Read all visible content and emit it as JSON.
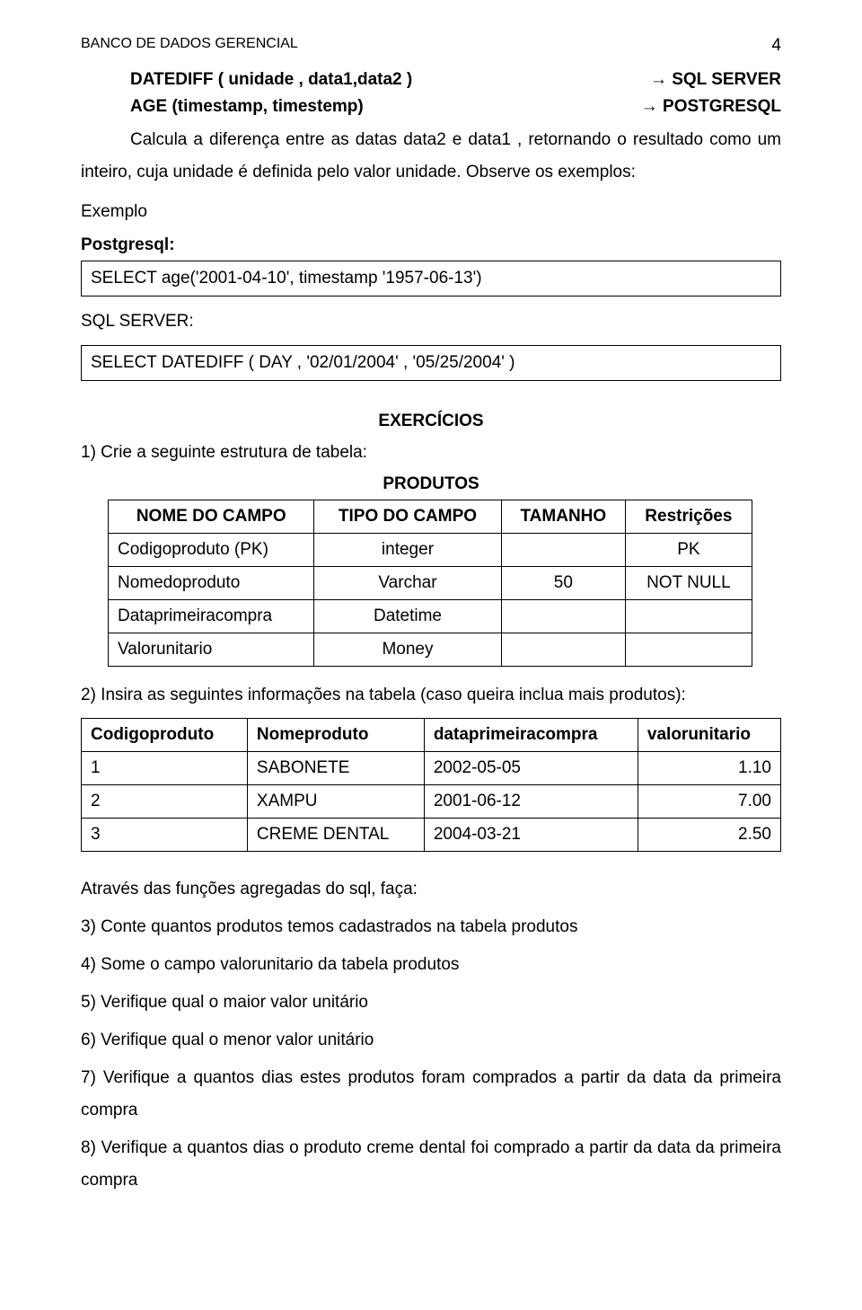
{
  "header": {
    "title": "BANCO DE DADOS GERENCIAL",
    "page_number": "4"
  },
  "funcs": {
    "row1_left": "DATEDIFF ( unidade , data1,data2 )",
    "row1_right": "→ SQL SERVER",
    "row2_left": "AGE (timestamp, timestemp)",
    "row2_right": "→ POSTGRESQL"
  },
  "desc": "Calcula a diferença entre as datas data2 e data1 , retornando o resultado como um inteiro, cuja unidade é definida pelo valor unidade. Observe os exemplos:",
  "labels": {
    "exemplo": "Exemplo",
    "postgresql": "Postgresql:",
    "sqlserver": "SQL SERVER:",
    "exercicios": "EXERCÍCIOS",
    "produtos": "PRODUTOS"
  },
  "code": {
    "pg": "SELECT age('2001-04-10', timestamp '1957-06-13')",
    "ms": "SELECT DATEDIFF ( DAY , '02/01/2004' , '05/25/2004' )"
  },
  "ex1": "1) Crie a seguinte estrutura de tabela:",
  "table1": {
    "headers": [
      "NOME DO CAMPO",
      "TIPO DO CAMPO",
      "TAMANHO",
      "Restrições"
    ],
    "rows": [
      [
        "Codigoproduto (PK)",
        "integer",
        "",
        "PK"
      ],
      [
        "Nomedoproduto",
        "Varchar",
        "50",
        "NOT NULL"
      ],
      [
        "Dataprimeiracompra",
        "Datetime",
        "",
        ""
      ],
      [
        "Valorunitario",
        "Money",
        "",
        ""
      ]
    ]
  },
  "ex2": "2) Insira as seguintes informações na tabela (caso queira inclua mais produtos):",
  "table2": {
    "headers": [
      "Codigoproduto",
      "Nomeproduto",
      "dataprimeiracompra",
      "valorunitario"
    ],
    "rows": [
      [
        "1",
        "SABONETE",
        "2002-05-05",
        "1.10"
      ],
      [
        "2",
        "XAMPU",
        "2001-06-12",
        "7.00"
      ],
      [
        "3",
        "CREME DENTAL",
        "2004-03-21",
        "2.50"
      ]
    ]
  },
  "post_heading": "Através das funções agregadas do sql, faça:",
  "items": {
    "i3": "3) Conte quantos produtos temos cadastrados na tabela produtos",
    "i4": "4) Some o campo valorunitario da tabela produtos",
    "i5": "5) Verifique qual o maior valor unitário",
    "i6": "6) Verifique qual o menor valor unitário",
    "i7": "7) Verifique a quantos dias estes produtos foram comprados a partir da data da primeira compra",
    "i8": "8) Verifique a quantos dias o produto creme dental foi comprado a partir da data da primeira compra"
  }
}
